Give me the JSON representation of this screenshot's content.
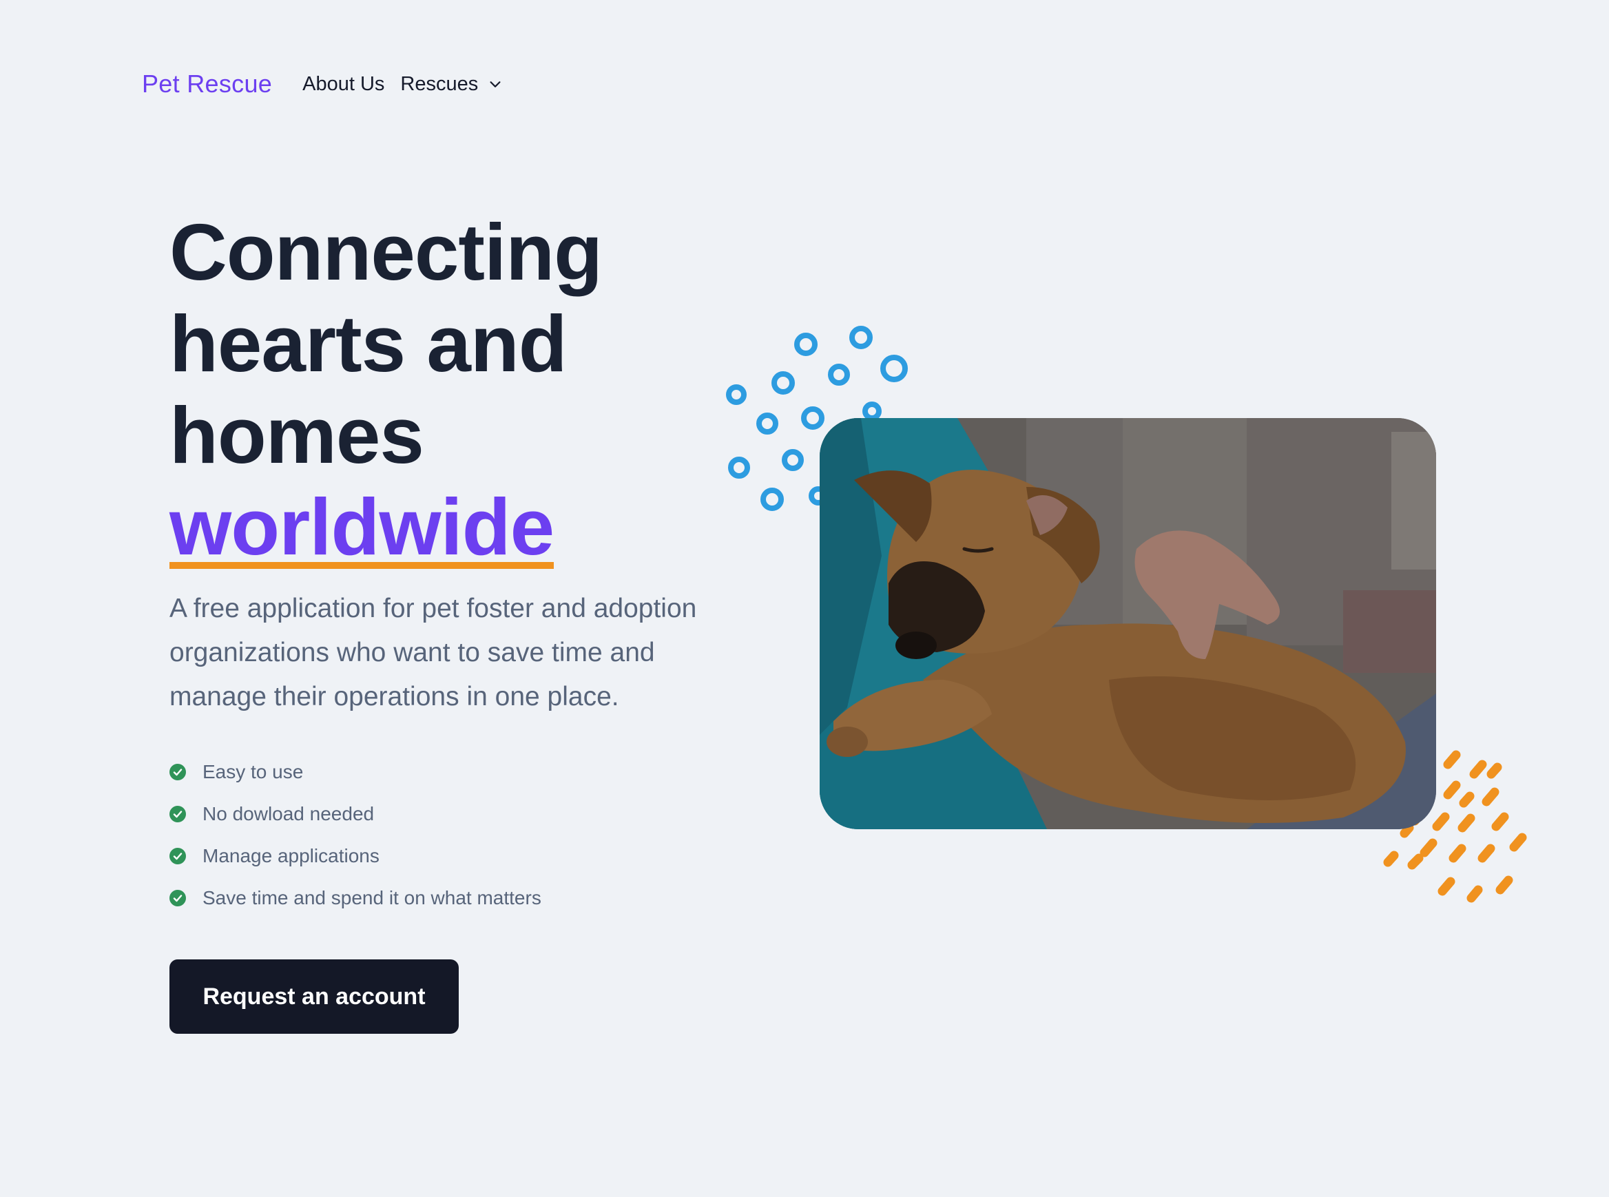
{
  "nav": {
    "brand": "Pet Rescue",
    "about": "About Us",
    "rescues": "Rescues"
  },
  "hero": {
    "headline_lines": [
      "Connecting",
      "hearts and",
      "homes"
    ],
    "headline_accent": "worldwide",
    "description": "A free application for pet foster and adoption organizations who want to save time and manage their operations in one place.",
    "features": [
      "Easy to use",
      "No dowload needed",
      "Manage applications",
      "Save time and spend it on what matters"
    ],
    "cta": "Request an account"
  },
  "colors": {
    "background": "#eff2f6",
    "brand": "#6c3ff0",
    "headline": "#1a2233",
    "body_text": "#57647a",
    "check": "#2f9358",
    "accent_underline": "#f0921f",
    "button": "#141827",
    "dots_blue": "#2d9ce0",
    "dashes_orange": "#f0921f"
  },
  "icons": {
    "dropdown": "chevron-down-icon",
    "feature": "check-circle-icon",
    "photo": "sleeping-puppy-photo"
  }
}
